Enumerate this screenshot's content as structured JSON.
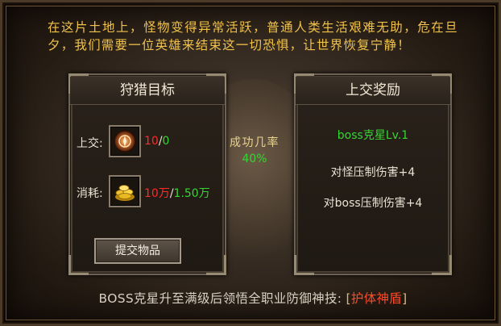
{
  "intro_text": "在这片土地上，怪物变得异常活跃，普通人类生活艰难无助，危在旦夕，我们需要一位英雄来结束这一切恐惧，让世界恢复宁静！",
  "hunt_panel": {
    "title": "狩猎目标",
    "submit": {
      "label": "上交:",
      "current": "10",
      "separator": "/",
      "required": "0",
      "icon": "monster-core-icon"
    },
    "cost": {
      "label": "消耗:",
      "current": "10万",
      "separator": "/",
      "required": "1.50万",
      "icon": "gold-coins-icon"
    },
    "submit_button": "提交物品"
  },
  "success_rate": {
    "label": "成功几率",
    "value": "40%"
  },
  "reward_panel": {
    "title": "上交奖励",
    "level_text": "boss克星Lv.1",
    "bonus_monster": "对怪压制伤害+4",
    "bonus_boss": "对boss压制伤害+4"
  },
  "footer": {
    "text": "BOSS克星升至满级后领悟全职业防御神技:",
    "bracket_open": "[",
    "skill": "护体神盾",
    "bracket_close": "]"
  },
  "colors": {
    "intro": "#f1c24a",
    "insufficient": "#ff2a2a",
    "sufficient": "#34d634",
    "skill": "#ff4a2a"
  }
}
